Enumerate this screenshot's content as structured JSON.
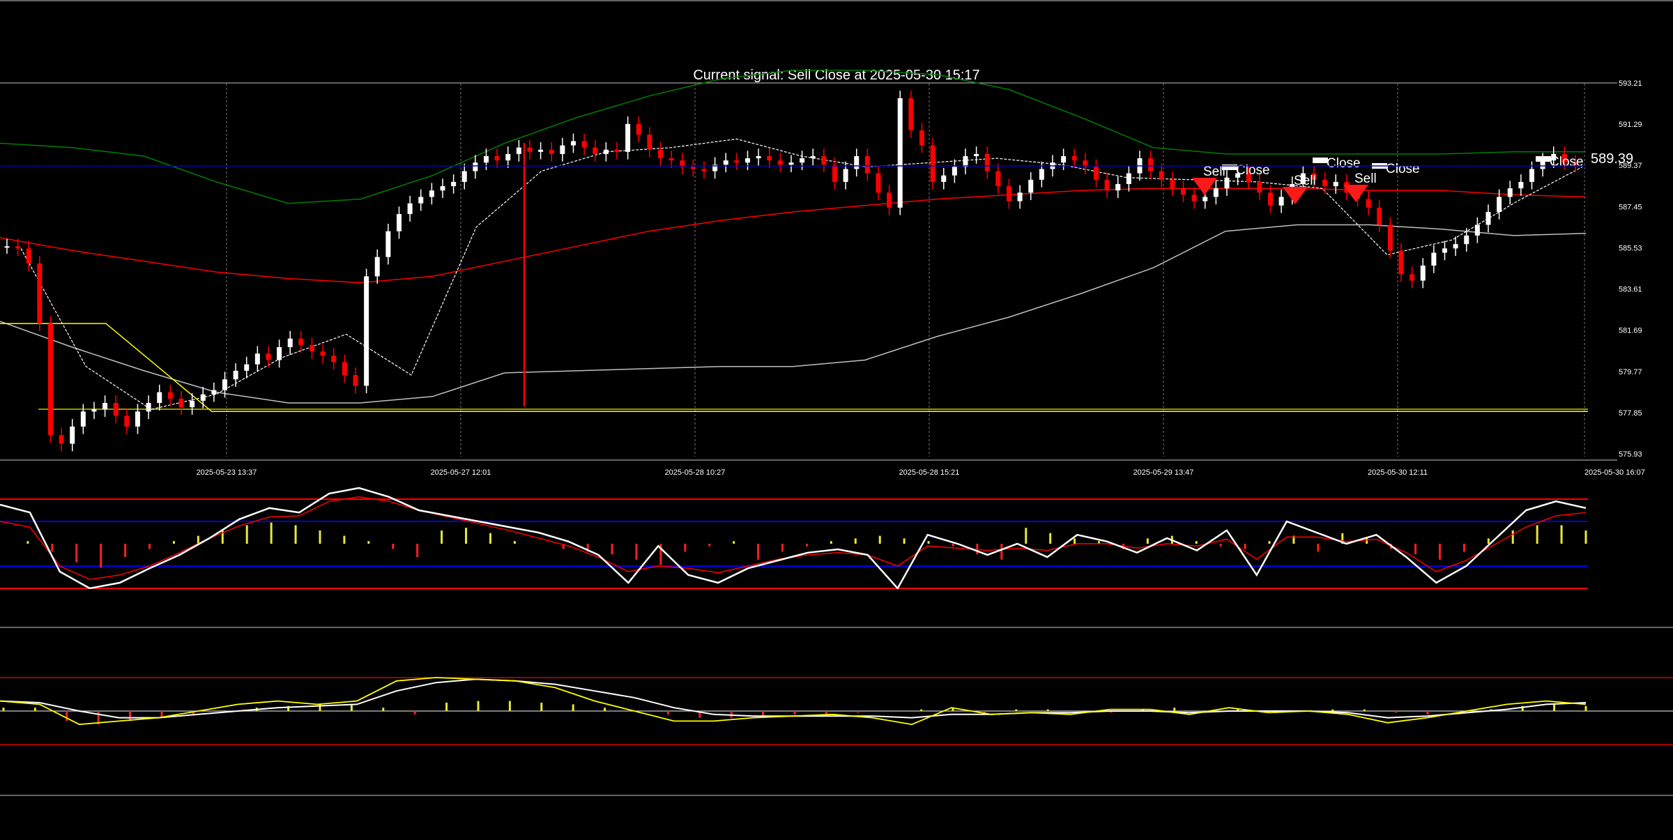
{
  "chart_data": {
    "type": "candlestick",
    "title": "Current signal: Sell Close at 2025-05-30 15:17",
    "last_price_label": "589.39",
    "price_axis": {
      "ylim": [
        575.93,
        593.21
      ],
      "ticks": [
        "593.21",
        "591.29",
        "589.37",
        "587.45",
        "585.53",
        "583.61",
        "581.69",
        "579.77",
        "577.85",
        "575.93"
      ]
    },
    "time_axis": {
      "ticks": [
        "2025-05-23 13:37",
        "2025-05-27 12:01",
        "2025-05-28 10:27",
        "2025-05-28 15:21",
        "2025-05-29 13:47",
        "2025-05-30 12:11",
        "2025-05-30 16:07"
      ]
    },
    "grid": true,
    "candles_close_approx": [
      585.6,
      585.5,
      584.8,
      582.0,
      576.8,
      576.4,
      577.2,
      577.9,
      578.0,
      578.3,
      577.7,
      577.2,
      577.9,
      578.3,
      578.8,
      578.5,
      578.1,
      578.4,
      578.7,
      578.9,
      579.4,
      579.8,
      580.1,
      580.6,
      580.3,
      580.9,
      581.3,
      581.0,
      580.7,
      580.5,
      580.2,
      579.6,
      579.1,
      584.2,
      585.1,
      586.3,
      587.1,
      587.6,
      587.9,
      588.2,
      588.4,
      588.6,
      589.1,
      589.5,
      589.8,
      589.6,
      589.9,
      590.2,
      590.0,
      590.1,
      589.9,
      590.3,
      590.5,
      590.2,
      589.9,
      590.1,
      590.0,
      591.3,
      590.8,
      590.1,
      589.7,
      589.6,
      589.3,
      589.2,
      589.1,
      589.4,
      589.6,
      589.5,
      589.7,
      589.8,
      589.6,
      589.4,
      589.5,
      589.7,
      589.8,
      589.4,
      588.6,
      589.2,
      589.8,
      589.0,
      588.1,
      587.4,
      592.5,
      591.0,
      590.3,
      588.6,
      588.9,
      589.3,
      589.8,
      589.9,
      589.1,
      588.4,
      587.7,
      588.1,
      588.7,
      589.2,
      589.5,
      589.8,
      589.6,
      589.3,
      588.7,
      588.2,
      588.5,
      589.0,
      589.7,
      589.1,
      588.7,
      588.3,
      588.0,
      587.7,
      587.9,
      588.3,
      588.8,
      589.0,
      588.6,
      588.1,
      587.5,
      587.9,
      588.5,
      589.0,
      588.7,
      588.4,
      588.6,
      588.1,
      587.8,
      587.4,
      586.6,
      585.4,
      584.3,
      584.0,
      584.7,
      585.3,
      585.5,
      585.7,
      586.1,
      586.6,
      587.2,
      587.9,
      588.3,
      588.6,
      589.2,
      589.6,
      589.9,
      589.5,
      589.4
    ],
    "overlays": [
      {
        "color": "#008000",
        "values": [
          590.4,
          590.2,
          589.8,
          588.6,
          587.6,
          587.8,
          588.9,
          590.4,
          591.6,
          592.6,
          593.4,
          593.8,
          593.8,
          593.6,
          592.9,
          591.6,
          590.2,
          589.9,
          589.9,
          589.9,
          589.9,
          590.0,
          590.0
        ]
      },
      {
        "color": "#ff0000",
        "values": [
          586.0,
          585.4,
          584.9,
          584.4,
          584.1,
          583.9,
          584.2,
          584.9,
          585.6,
          586.3,
          586.8,
          587.2,
          587.5,
          587.8,
          588.0,
          588.2,
          588.3,
          588.3,
          588.3,
          588.2,
          588.2,
          588.0,
          587.9
        ]
      },
      {
        "color": "#c0c0c0",
        "values": [
          582.1,
          580.9,
          579.8,
          578.8,
          578.3,
          578.3,
          578.6,
          579.7,
          579.8,
          579.9,
          580.0,
          580.0,
          580.3,
          581.4,
          582.3,
          583.4,
          584.6,
          586.3,
          586.6,
          586.6,
          586.4,
          586.1,
          586.2
        ]
      },
      {
        "color": "#ffffff",
        "values": [
          585.5,
          580.0,
          578.0,
          578.7,
          580.4,
          581.5,
          579.6,
          586.5,
          589.1,
          590.0,
          590.2,
          590.6,
          589.8,
          589.3,
          589.5,
          589.7,
          589.4,
          588.8,
          588.7,
          588.6,
          588.3,
          585.2,
          585.9,
          587.7,
          589.3
        ]
      },
      {
        "color": "#ffff00",
        "values": [
          582.0,
          582.0,
          577.9,
          577.9,
          577.9,
          577.9,
          577.9,
          577.9,
          577.9,
          577.9,
          577.9,
          577.9,
          577.9,
          577.9,
          577.9,
          577.9
        ]
      }
    ],
    "signals": [
      {
        "label": "Sell"
      },
      {
        "label": "Close"
      },
      {
        "label": "Sell"
      },
      {
        "label": "Close"
      },
      {
        "label": "Sell"
      },
      {
        "label": "Close"
      },
      {
        "label": "Close"
      }
    ],
    "oscillator_1": {
      "levels": [
        90,
        70,
        30,
        10
      ],
      "histogram": [
        0,
        0.1,
        -0.3,
        -0.7,
        -0.9,
        -0.5,
        -0.2,
        0.1,
        0.3,
        0.5,
        0.7,
        0.8,
        0.7,
        0.5,
        0.3,
        0.1,
        -0.2,
        -0.5,
        0.5,
        0.6,
        0.4,
        0.1,
        0,
        -0.2,
        -0.3,
        -0.4,
        -0.6,
        -0.8,
        -0.3,
        -0.1,
        0.1,
        -0.6,
        -0.3,
        -0.1,
        0.1,
        0.2,
        0.3,
        0.2,
        0.1,
        -0.1,
        -0.4,
        -0.6,
        0.6,
        0.4,
        0.2,
        0.1,
        -0.2,
        0.2,
        0.3,
        0.1,
        -0.1,
        -0.2,
        0.1,
        0.3,
        -0.3,
        0.4,
        0.2,
        -0.2,
        -0.4,
        -0.6,
        -0.3,
        0.2,
        0.5,
        0.7,
        0.7,
        0.5
      ],
      "main_line": [
        85,
        78,
        25,
        10,
        15,
        28,
        40,
        55,
        72,
        82,
        78,
        95,
        100,
        92,
        80,
        75,
        70,
        65,
        60,
        52,
        40,
        15,
        48,
        22,
        15,
        28,
        35,
        42,
        45,
        40,
        10,
        58,
        50,
        40,
        50,
        38,
        58,
        52,
        42,
        55,
        44,
        62,
        22,
        70,
        60,
        50,
        58,
        38,
        15,
        30,
        55,
        80,
        88,
        82
      ],
      "signal_line": [
        70,
        65,
        30,
        18,
        22,
        30,
        42,
        55,
        66,
        74,
        75,
        88,
        92,
        88,
        80,
        74,
        68,
        62,
        55,
        48,
        38,
        25,
        30,
        28,
        24,
        30,
        36,
        40,
        42,
        40,
        30,
        48,
        46,
        44,
        46,
        44,
        50,
        50,
        46,
        50,
        48,
        54,
        36,
        56,
        56,
        52,
        54,
        42,
        25,
        35,
        50,
        65,
        75,
        78
      ]
    },
    "oscillator_2": {
      "levels": [
        1,
        0,
        -1
      ],
      "histogram": [
        0.1,
        0.1,
        -0.3,
        -0.4,
        -0.3,
        -0.2,
        -0.1,
        0,
        0.1,
        0.15,
        0.2,
        0.2,
        0.1,
        -0.1,
        0.25,
        0.3,
        0.3,
        0.25,
        0.2,
        0.1,
        0,
        -0.1,
        -0.2,
        -0.2,
        -0.15,
        -0.1,
        -0.1,
        -0.05,
        0,
        0.05,
        0.1,
        -0.05,
        0.05,
        0.05,
        0,
        -0.05,
        0.05,
        0.1,
        0,
        0.05,
        -0.05,
        0,
        0.05,
        0.05,
        -0.05,
        -0.1,
        -0.1,
        0.05,
        0.15,
        0.2,
        0.15
      ],
      "main_line": [
        0.3,
        0.2,
        -0.4,
        -0.3,
        -0.2,
        0.0,
        0.2,
        0.3,
        0.2,
        0.3,
        0.9,
        1.0,
        0.95,
        0.9,
        0.7,
        0.3,
        0.0,
        -0.3,
        -0.3,
        -0.2,
        -0.15,
        -0.1,
        -0.2,
        -0.4,
        0.1,
        -0.1,
        -0.05,
        -0.1,
        0.05,
        0.05,
        -0.1,
        0.1,
        -0.05,
        0.0,
        -0.1,
        -0.35,
        -0.2,
        0.0,
        0.2,
        0.3,
        0.2
      ],
      "signal_line": [
        0.3,
        0.25,
        0.0,
        -0.2,
        -0.2,
        -0.1,
        0.0,
        0.1,
        0.15,
        0.2,
        0.6,
        0.85,
        0.95,
        0.9,
        0.8,
        0.6,
        0.4,
        0.1,
        -0.1,
        -0.15,
        -0.15,
        -0.15,
        -0.15,
        -0.2,
        -0.1,
        -0.1,
        -0.05,
        -0.05,
        0.0,
        0.0,
        -0.05,
        0.0,
        0.0,
        0.0,
        -0.05,
        -0.2,
        -0.15,
        -0.05,
        0.05,
        0.2,
        0.25
      ]
    }
  }
}
